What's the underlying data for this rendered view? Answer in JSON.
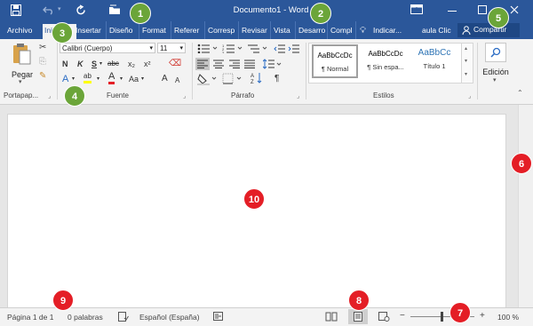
{
  "window": {
    "title": "Documento1  -  Word"
  },
  "tabs": [
    "Archivo",
    "Inicio",
    "Insertar",
    "Diseño",
    "Format",
    "Referer",
    "Corresp",
    "Revisar",
    "Vista",
    "Desarro",
    "Compl"
  ],
  "tell_me": "Indicar...",
  "user": "aula Clic",
  "share": "Compartir",
  "ribbon": {
    "paste_label": "Pegar",
    "clipboard_group": "Portapap...",
    "font_name": "Calibri (Cuerpo)",
    "font_size": "11",
    "font_group": "Fuente",
    "bold": "N",
    "italic": "K",
    "underline": "S",
    "strike": "abc",
    "subscript": "x₂",
    "superscript": "x²",
    "case": "Aa",
    "grow": "A",
    "shrink": "A",
    "paragraph_group": "Párrafo",
    "styles_group": "Estilos",
    "styles": [
      {
        "preview": "AaBbCcDc",
        "name": "¶ Normal"
      },
      {
        "preview": "AaBbCcDc",
        "name": "¶ Sin espa..."
      },
      {
        "preview": "AaBbCc",
        "name": "Título 1"
      }
    ],
    "editing_label": "Edición"
  },
  "status": {
    "page": "Página 1 de 1",
    "words": "0 palabras",
    "language": "Español (España)",
    "zoom_minus": "−",
    "zoom_plus": "+",
    "zoom": "100 %"
  },
  "callouts": {
    "green": [
      "1",
      "2",
      "3",
      "4",
      "5"
    ],
    "red": [
      "6",
      "7",
      "8",
      "9",
      "10"
    ]
  },
  "colors": {
    "brand": "#2b579a",
    "green_badge": "#6ba539",
    "red_badge": "#e41e26"
  }
}
